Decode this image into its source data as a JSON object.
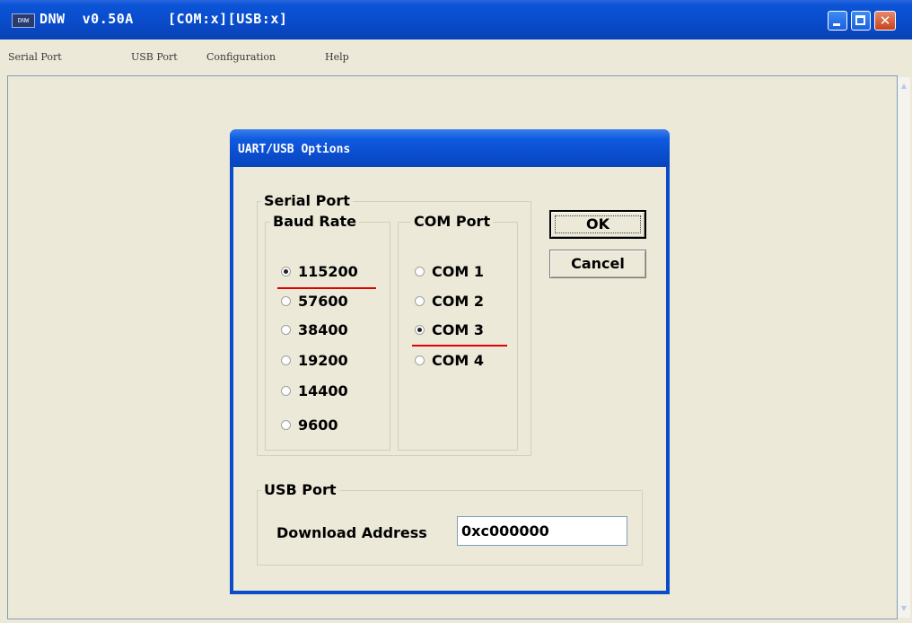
{
  "window": {
    "title": "DNW  v0.50A    [COM:x][USB:x]",
    "icon_text": "DNW"
  },
  "menu": [
    "Serial Port",
    "USB Port",
    "Configuration",
    "Help"
  ],
  "dialog": {
    "title": "UART/USB Options",
    "serial_port_label": "Serial Port",
    "baud_rate_label": "Baud Rate",
    "com_port_label": "COM Port",
    "baud_rates": [
      {
        "label": "115200",
        "checked": true
      },
      {
        "label": "57600",
        "checked": false
      },
      {
        "label": "38400",
        "checked": false
      },
      {
        "label": "19200",
        "checked": false
      },
      {
        "label": "14400",
        "checked": false
      },
      {
        "label": "9600",
        "checked": false
      }
    ],
    "com_ports": [
      {
        "label": "COM 1",
        "checked": false
      },
      {
        "label": "COM 2",
        "checked": false
      },
      {
        "label": "COM 3",
        "checked": true
      },
      {
        "label": "COM 4",
        "checked": false
      }
    ],
    "ok_label": "OK",
    "cancel_label": "Cancel",
    "usb_port_label": "USB Port",
    "download_address_label": "Download Address",
    "download_address_value": "0xc000000"
  },
  "colors": {
    "titlebar": "#0a4ccc",
    "highlight_underline": "#e00000",
    "dialog_background": "#ece9d8"
  }
}
